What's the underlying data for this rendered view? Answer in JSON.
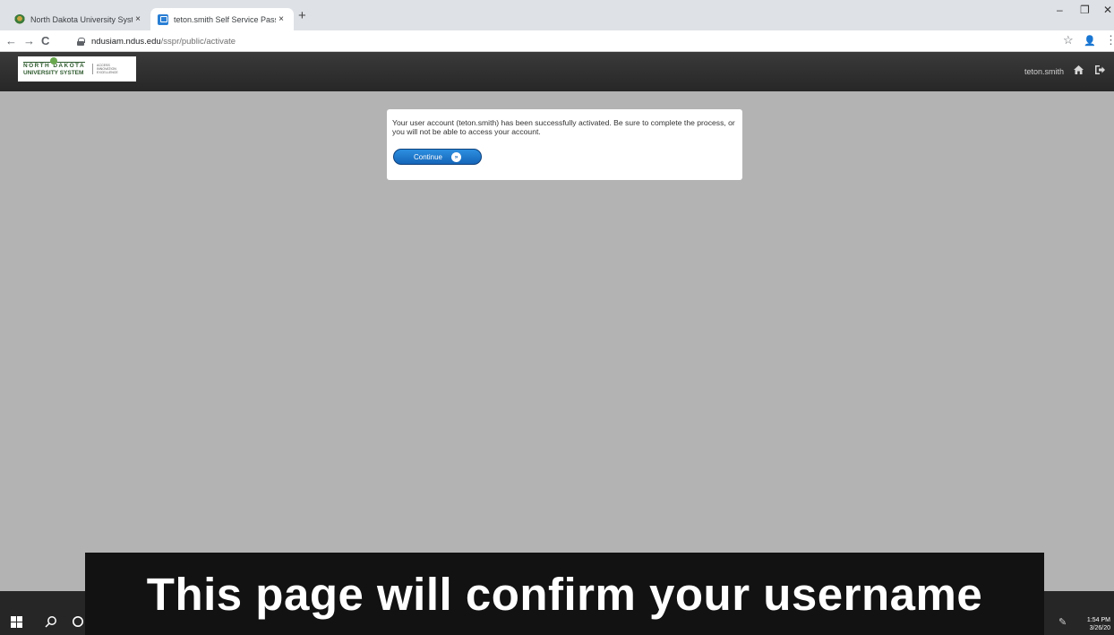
{
  "browser": {
    "tabs": [
      {
        "title": "North Dakota University System",
        "icon": "ndus-favicon",
        "active": false
      },
      {
        "title": "teton.smith Self Service Passwor",
        "icon": "sspr-favicon",
        "active": true
      }
    ],
    "new_tab_symbol": "+",
    "close_symbol": "×",
    "window_controls": {
      "minimize": "–",
      "restore": "❐",
      "close": "✕"
    },
    "nav": {
      "back": "←",
      "forward": "→",
      "reload": "C"
    },
    "url_host": "ndusiam.ndus.edu",
    "url_path": "/sspr/public/activate",
    "star_symbol": "☆",
    "profile_symbol": "👤",
    "menu_symbol": "⋮"
  },
  "header": {
    "logo": {
      "line1": "NORTH DAKOTA",
      "line2": "UNIVERSITY SYSTEM",
      "tagline": "ACCESS INNOVATION EXCELLENCE"
    },
    "username": "teton.smith",
    "home_icon": "home-icon",
    "logout_icon": "logout-icon"
  },
  "card": {
    "message": "Your user account (teton.smith) has been successfully activated. Be sure to complete the process, or you will not be able to access your account.",
    "continue_label": "Continue",
    "continue_icon_glyph": "»"
  },
  "taskbar": {
    "time": "1:54 PM",
    "date": "3/26/20"
  },
  "caption": {
    "text": "This page will confirm your username"
  },
  "colors": {
    "page_bg": "#b3b3b3",
    "header_bg": "#2e2e2e",
    "button_blue": "#1a73c8",
    "caption_bg": "#121212"
  }
}
